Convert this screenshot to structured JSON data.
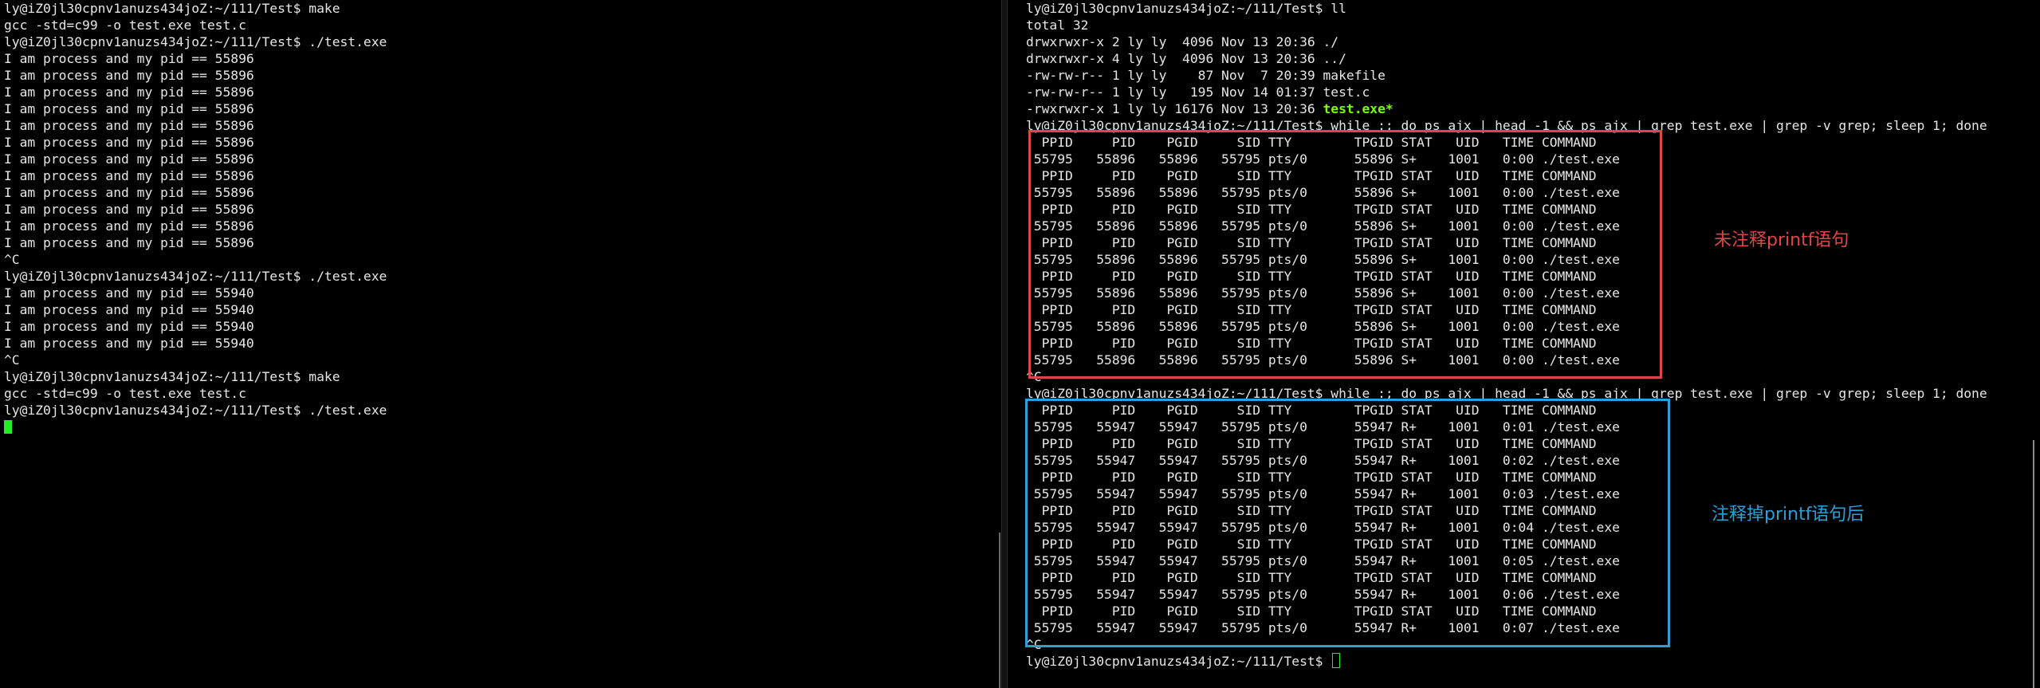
{
  "left_terminal": {
    "lines": [
      "ly@iZ0jl30cpnv1anuzs434joZ:~/111/Test$ make",
      "gcc -std=c99 -o test.exe test.c",
      "ly@iZ0jl30cpnv1anuzs434joZ:~/111/Test$ ./test.exe",
      "I am process and my pid == 55896",
      "I am process and my pid == 55896",
      "I am process and my pid == 55896",
      "I am process and my pid == 55896",
      "I am process and my pid == 55896",
      "I am process and my pid == 55896",
      "I am process and my pid == 55896",
      "I am process and my pid == 55896",
      "I am process and my pid == 55896",
      "I am process and my pid == 55896",
      "I am process and my pid == 55896",
      "I am process and my pid == 55896",
      "^C",
      "ly@iZ0jl30cpnv1anuzs434joZ:~/111/Test$ ./test.exe",
      "I am process and my pid == 55940",
      "I am process and my pid == 55940",
      "I am process and my pid == 55940",
      "I am process and my pid == 55940",
      "^C",
      "ly@iZ0jl30cpnv1anuzs434joZ:~/111/Test$ make",
      "gcc -std=c99 -o test.exe test.c",
      "ly@iZ0jl30cpnv1anuzs434joZ:~/111/Test$ ./test.exe"
    ]
  },
  "right_terminal": {
    "ls_output": [
      "ly@iZ0jl30cpnv1anuzs434joZ:~/111/Test$ ll",
      "total 32",
      "drwxrwxr-x 2 ly ly  4096 Nov 13 20:36 ./",
      "drwxrwxr-x 4 ly ly  4096 Nov 13 20:36 ../",
      "-rw-rw-r-- 1 ly ly    87 Nov  7 20:39 makefile",
      "-rw-rw-r-- 1 ly ly   195 Nov 14 01:37 test.c"
    ],
    "exe_line_prefix": "-rwxrwxr-x 1 ly ly 16176 Nov 13 20:36 ",
    "exe_line_name": "test.exe*",
    "loop_command": "ly@iZ0jl30cpnv1anuzs434joZ:~/111/Test$ while :; do ps ajx | head -1 && ps ajx | grep test.exe | grep -v grep; sleep 1; done",
    "ps_header": "  PPID     PID    PGID     SID TTY        TPGID STAT   UID   TIME COMMAND",
    "first_run_rows": [
      " 55795   55896   55896   55795 pts/0      55896 S+    1001   0:00 ./test.exe",
      " 55795   55896   55896   55795 pts/0      55896 S+    1001   0:00 ./test.exe",
      " 55795   55896   55896   55795 pts/0      55896 S+    1001   0:00 ./test.exe",
      " 55795   55896   55896   55795 pts/0      55896 S+    1001   0:00 ./test.exe",
      " 55795   55896   55896   55795 pts/0      55896 S+    1001   0:00 ./test.exe",
      " 55795   55896   55896   55795 pts/0      55896 S+    1001   0:00 ./test.exe",
      " 55795   55896   55896   55795 pts/0      55896 S+    1001   0:00 ./test.exe"
    ],
    "second_run_rows": [
      " 55795   55947   55947   55795 pts/0      55947 R+    1001   0:01 ./test.exe",
      " 55795   55947   55947   55795 pts/0      55947 R+    1001   0:02 ./test.exe",
      " 55795   55947   55947   55795 pts/0      55947 R+    1001   0:03 ./test.exe",
      " 55795   55947   55947   55795 pts/0      55947 R+    1001   0:04 ./test.exe",
      " 55795   55947   55947   55795 pts/0      55947 R+    1001   0:05 ./test.exe",
      " 55795   55947   55947   55795 pts/0      55947 R+    1001   0:06 ./test.exe",
      " 55795   55947   55947   55795 pts/0      55947 R+    1001   0:07 ./test.exe"
    ],
    "interrupt": "^C",
    "final_prompt": "ly@iZ0jl30cpnv1anuzs434joZ:~/111/Test$ "
  },
  "annotations": {
    "red_label": "未注释printf语句",
    "blue_label": "注释掉printf语句后",
    "red_color": "#e04545",
    "blue_color": "#2aa0d8"
  },
  "colors": {
    "terminal_bg": "#000000",
    "terminal_fg": "#e6e6e6",
    "cursor": "#22ee22",
    "exe_highlight": "#7CFC00"
  }
}
